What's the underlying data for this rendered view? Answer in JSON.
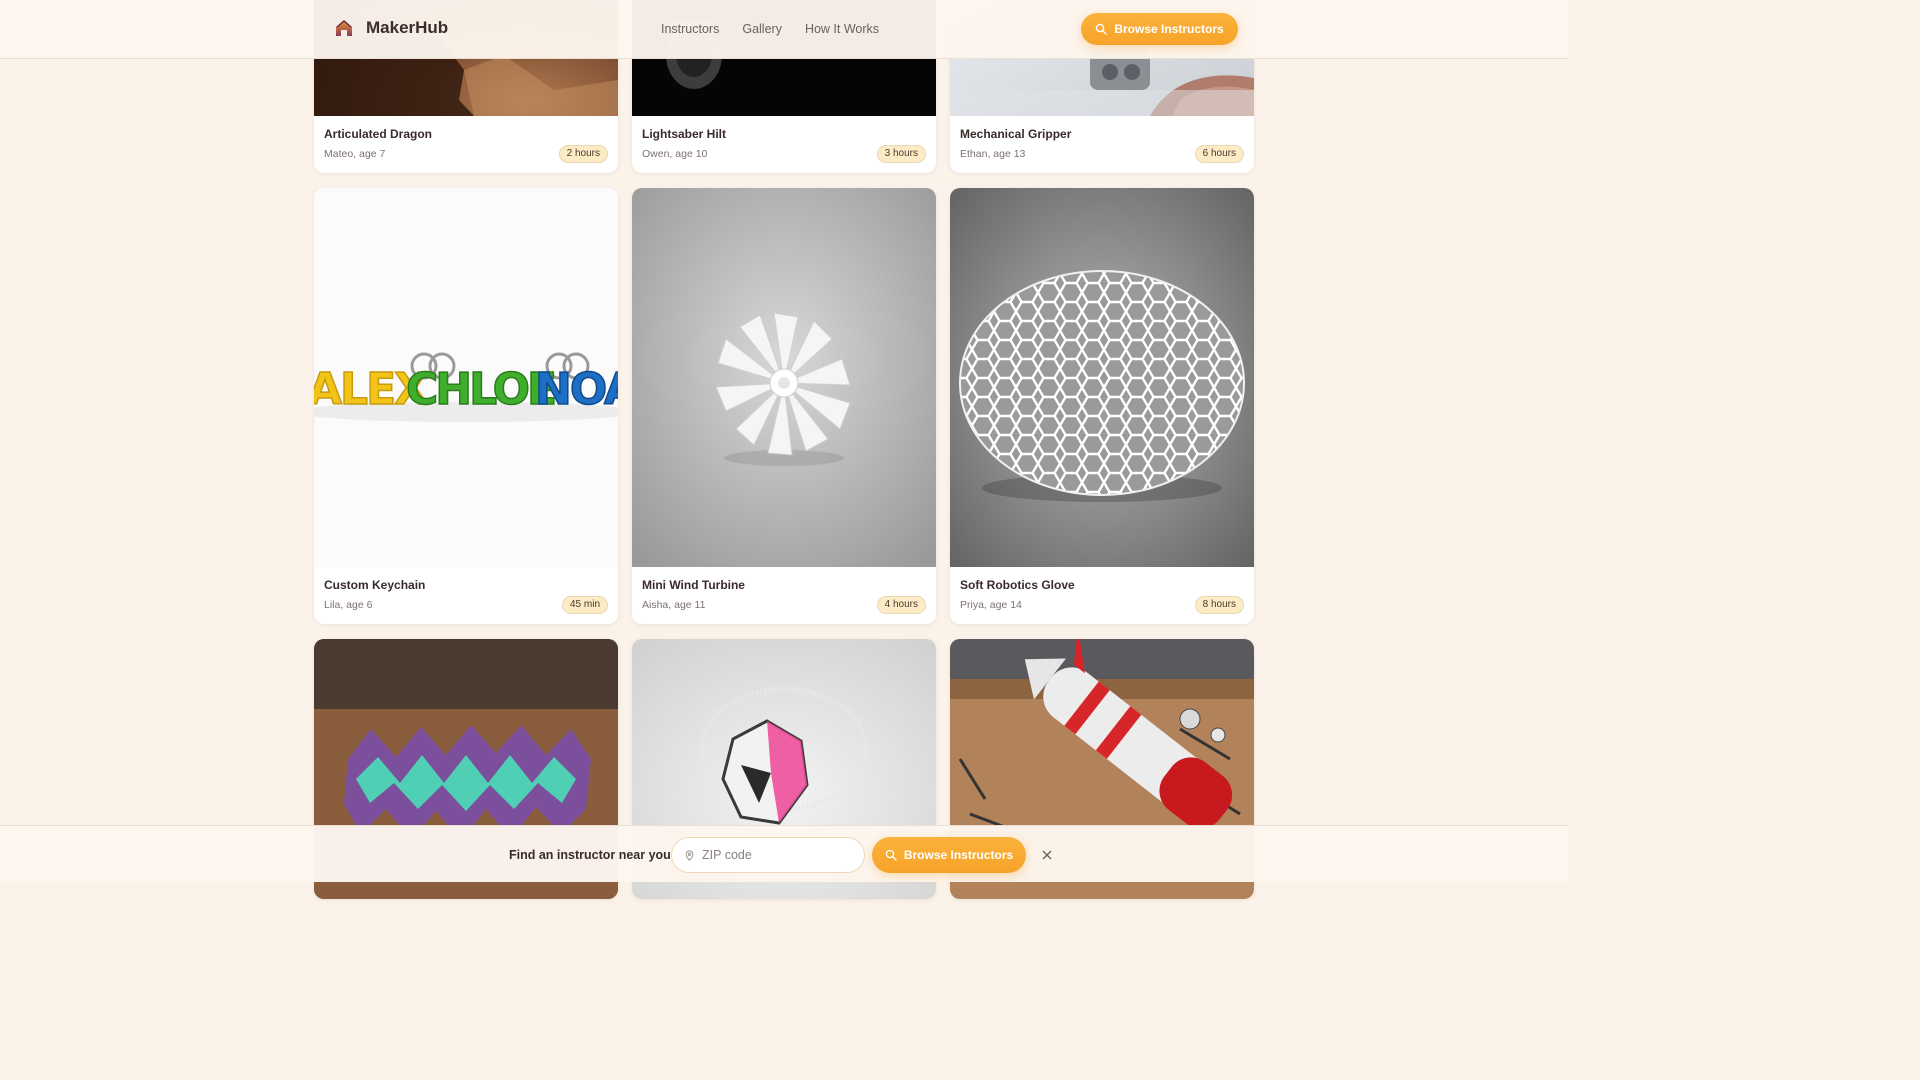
{
  "header": {
    "logo_text": "MakerHub",
    "nav": [
      "Instructors",
      "Gallery",
      "How It Works"
    ],
    "cta_label": "Browse Instructors"
  },
  "gallery": {
    "cards": [
      {
        "title": "Articulated Dragon",
        "maker": "Mateo, age 7",
        "duration": "2 hours"
      },
      {
        "title": "Lightsaber Hilt",
        "maker": "Owen, age 10",
        "duration": "3 hours"
      },
      {
        "title": "Mechanical Gripper",
        "maker": "Ethan, age 13",
        "duration": "6 hours"
      },
      {
        "title": "Custom Keychain",
        "maker": "Lila, age 6",
        "duration": "45 min"
      },
      {
        "title": "Mini Wind Turbine",
        "maker": "Aisha, age 11",
        "duration": "4 hours"
      },
      {
        "title": "Soft Robotics Glove",
        "maker": "Priya, age 14",
        "duration": "8 hours"
      },
      {
        "title": "",
        "maker": "",
        "duration": ""
      },
      {
        "title": "",
        "maker": "",
        "duration": ""
      },
      {
        "title": "",
        "maker": "",
        "duration": ""
      }
    ],
    "keychain_names": [
      "ALEX",
      "CHLOE",
      "NOA"
    ]
  },
  "bottom_bar": {
    "label": "Find an instructor near you:",
    "zip_placeholder": "ZIP code",
    "cta_label": "Browse Instructors"
  },
  "colors": {
    "accent": "#f7a32a",
    "background": "#fbf3ea",
    "badge": "#fcebc4"
  },
  "icons": {
    "logo": "house-logo-icon",
    "search": "search-icon",
    "location": "location-pin-icon",
    "close": "close-icon"
  }
}
